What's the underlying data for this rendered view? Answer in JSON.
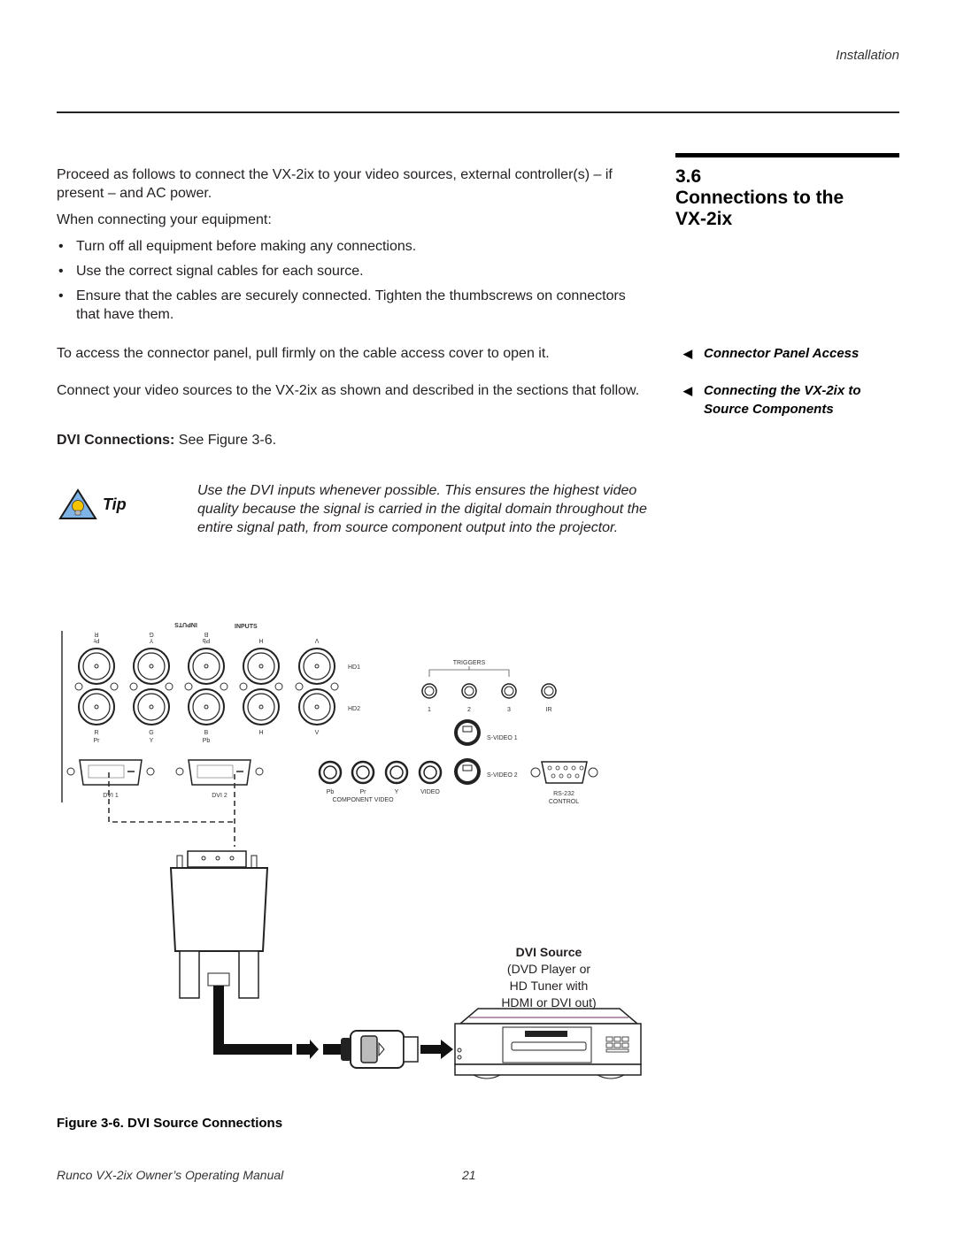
{
  "header": {
    "running_head": "Installation"
  },
  "section": {
    "number": "3.6",
    "title_line1": "Connections to the",
    "title_line2": "VX-2ix"
  },
  "body": {
    "intro": "Proceed as follows to connect the VX-2ix to your video sources, external controller(s) – if present – and AC power.",
    "when_connecting": "When connecting your equipment:",
    "bullets": [
      "Turn off all equipment before making any connections.",
      "Use the correct signal cables for each source.",
      "Ensure that the cables are securely connected. Tighten the thumbscrews on connectors that have them."
    ],
    "bullet_char": "•",
    "access_panel": "To access the connector panel, pull firmly on the cable access cover to open it.",
    "connect_sources": "Connect your video sources to the VX-2ix as shown and described in the sections that follow.",
    "dvi_label": "DVI Connections:",
    "dvi_ref": " See Figure 3-6."
  },
  "sidebar": {
    "arrow_icon": "◀",
    "links": [
      {
        "label": "Connector Panel Access"
      },
      {
        "label": "Connecting the VX-2ix to Source Components"
      }
    ]
  },
  "tip": {
    "icon": "lightbulb-warning-icon",
    "label": "Tip",
    "text": "Use the DVI inputs whenever possible. This ensures the highest video quality because the signal is carried in the digital domain throughout the entire signal path, from source component output into the projector."
  },
  "figure": {
    "panel": {
      "inputs_label": "INPUTS",
      "bnc_top_labels": [
        "Pr",
        "Y",
        "Pb",
        "H",
        "V"
      ],
      "bnc_top_labels2": [
        "R",
        "G",
        "B"
      ],
      "bnc_bottom_labels1": [
        "R",
        "G",
        "B",
        "H",
        "V"
      ],
      "bnc_bottom_labels2": [
        "Pr",
        "Y",
        "Pb"
      ],
      "hd_labels": [
        "HD1",
        "HD2"
      ],
      "dvi_labels": [
        "DVI 1",
        "DVI 2"
      ],
      "component_video": "COMPONENT VIDEO",
      "component_labels": [
        "Pb",
        "Pr",
        "Y"
      ],
      "video_label": "VIDEO",
      "triggers_label": "TRIGGERS",
      "trigger_labels": [
        "1",
        "2",
        "3"
      ],
      "ir_label": "IR",
      "svideo_labels": [
        "S-VIDEO 1",
        "S-VIDEO 2"
      ],
      "rs232_label": "RS-232",
      "control_label": "CONTROL"
    },
    "source": {
      "title": "DVI Source",
      "line1": "(DVD Player or",
      "line2": "HD Tuner with",
      "line3": "HDMI or DVI out)"
    },
    "caption": "Figure 3-6. DVI Source Connections"
  },
  "footer": {
    "manual_title": "Runco VX-2ix Owner’s Operating Manual",
    "page_number": "21"
  }
}
